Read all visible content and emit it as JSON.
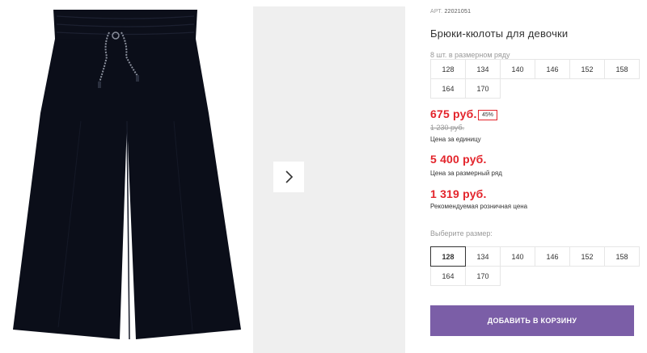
{
  "product": {
    "art_label": "АРТ.",
    "art_number": "22021051",
    "title": "Брюки-кюлоты для девочки",
    "image_icon": "wide-leg-pants-photo"
  },
  "gallery": {
    "next_icon": "chevron-right-icon"
  },
  "pack": {
    "note": "8 шт. в размерном ряду",
    "sizes": [
      "128",
      "134",
      "140",
      "146",
      "152",
      "158",
      "164",
      "170"
    ]
  },
  "prices": {
    "unit_price": "675 руб.",
    "discount": "45%",
    "old_price": "1 230 руб.",
    "unit_caption": "Цена за единицу",
    "pack_price": "5 400 руб.",
    "pack_caption": "Цена за размерный ряд",
    "retail_price": "1 319 руб.",
    "retail_caption": "Рекомендуемая розничная цена"
  },
  "size_select": {
    "label": "Выберите размер:",
    "sizes": [
      "128",
      "134",
      "140",
      "146",
      "152",
      "158",
      "164",
      "170"
    ],
    "selected": "128"
  },
  "cart": {
    "button_label": "ДОБАВИТЬ В КОРЗИНУ",
    "color": "#7b5ea7"
  },
  "colors": {
    "price_red": "#e3242b",
    "thumb_bg": "#efefef"
  }
}
